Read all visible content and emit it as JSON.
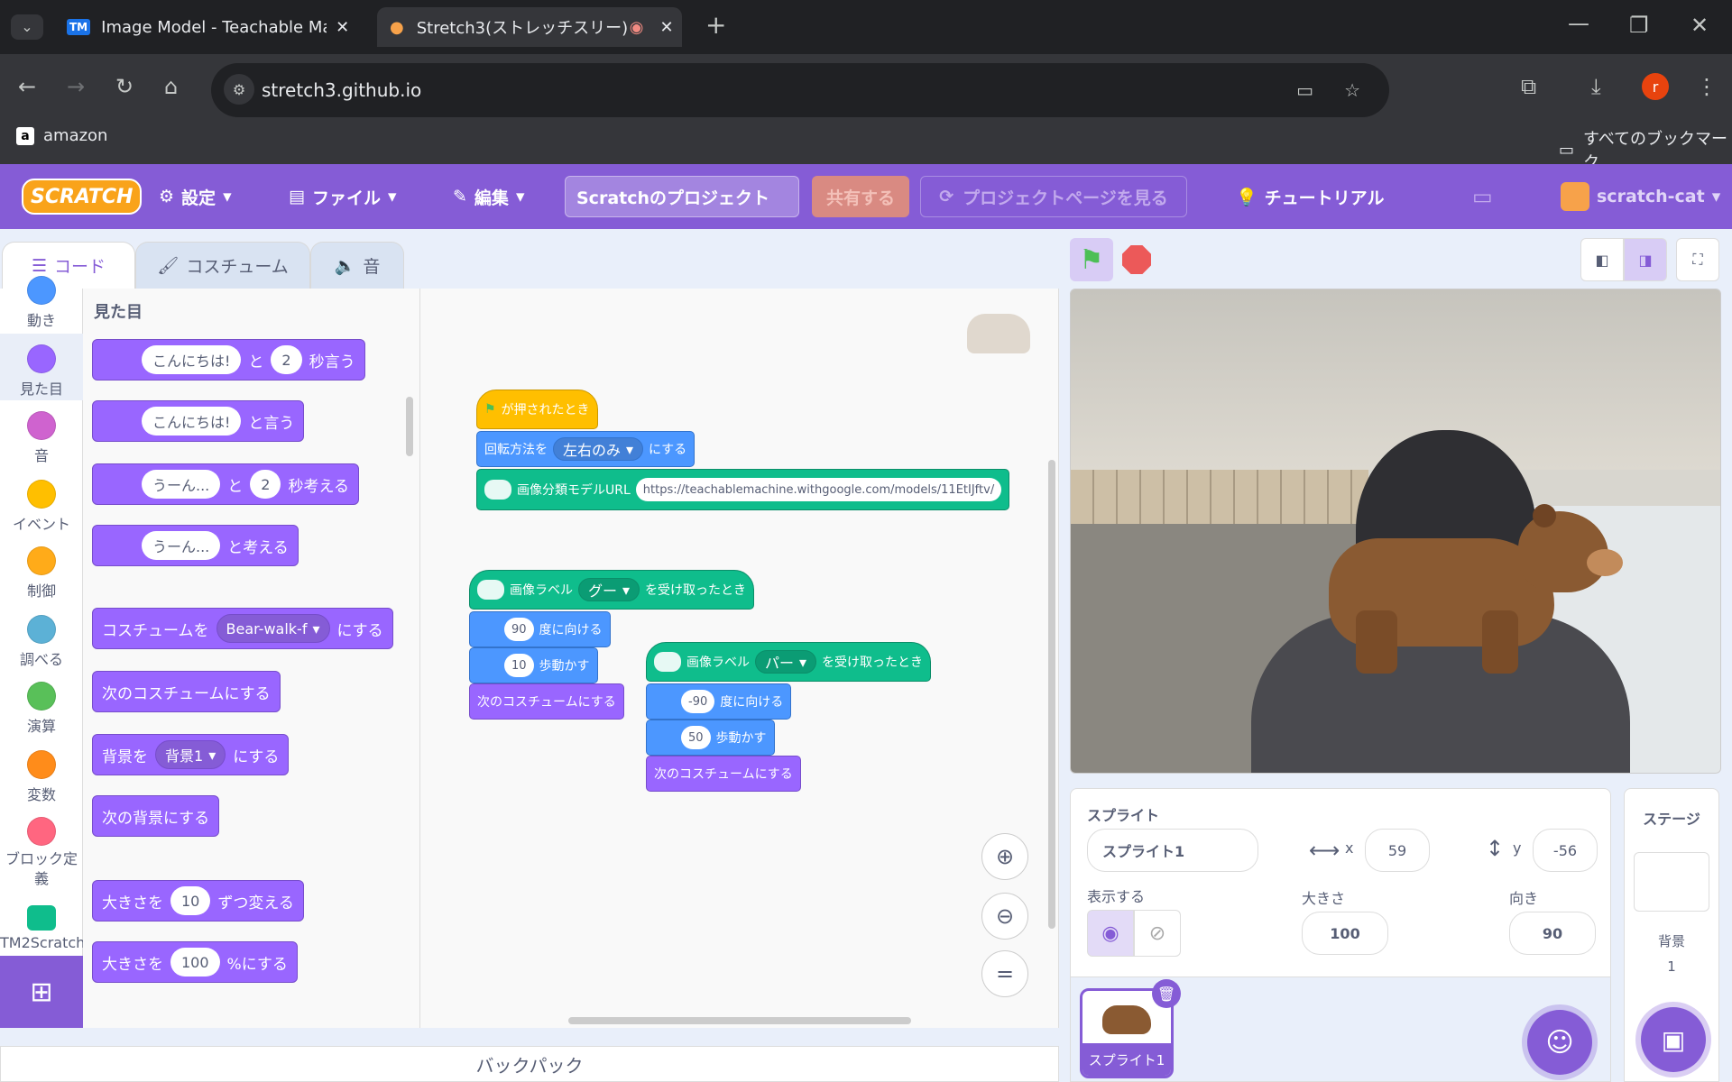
{
  "browser": {
    "tabs": [
      {
        "label": "Image Model - Teachable Mach",
        "icon": "TM"
      },
      {
        "label": "Stretch3(ストレッチスリー)"
      }
    ],
    "url": "stretch3.github.io",
    "bookmark": "amazon",
    "all_bookmarks": "すべてのブックマーク",
    "profile_initial": "r"
  },
  "menu": {
    "logo": "SCRATCH",
    "settings": "設定",
    "file": "ファイル",
    "edit": "編集",
    "project_title": "Scratchのプロジェクト",
    "share": "共有する",
    "see_project": "プロジェクトページを見る",
    "tutorial": "チュートリアル",
    "user": "scratch-cat"
  },
  "tabs": {
    "code": "コード",
    "costume": "コスチューム",
    "sound": "音"
  },
  "categories": [
    "動き",
    "見た目",
    "音",
    "イベント",
    "制御",
    "調べる",
    "演算",
    "変数",
    "ブロック定義",
    "TM2Scratch"
  ],
  "palette": {
    "heading": "見た目",
    "say_for": {
      "text": "こんにちは!",
      "mid": "と",
      "num": "2",
      "end": "秒言う"
    },
    "say": {
      "text": "こんにちは!",
      "end": "と言う"
    },
    "think_for": {
      "text": "うーん...",
      "mid": "と",
      "num": "2",
      "end": "秒考える"
    },
    "think": {
      "text": "うーん...",
      "end": "と考える"
    },
    "switch_costume": {
      "start": "コスチュームを",
      "value": "Bear-walk-f",
      "end": "にする"
    },
    "next_costume": "次のコスチュームにする",
    "switch_backdrop": {
      "start": "背景を",
      "value": "背景1",
      "end": "にする"
    },
    "next_backdrop": "次の背景にする",
    "change_size": {
      "start": "大きさを",
      "num": "10",
      "end": "ずつ変える"
    },
    "set_size": {
      "start": "大きさを",
      "num": "100",
      "end": "%にする"
    }
  },
  "script": {
    "flag_hat": "が押されたとき",
    "rotation": {
      "start": "回転方法を",
      "value": "左右のみ",
      "end": "にする"
    },
    "model_url": {
      "label": "画像分類モデルURL",
      "value": "https://teachablemachine.withgoogle.com/models/11EtIJftv/"
    },
    "hat1": {
      "start": "画像ラベル",
      "value": "グー",
      "end": "を受け取ったとき"
    },
    "dir1": {
      "num": "90",
      "end": "度に向ける"
    },
    "move1": {
      "num": "10",
      "end": "歩動かす"
    },
    "next1": "次のコスチュームにする",
    "hat2": {
      "start": "画像ラベル",
      "value": "パー",
      "end": "を受け取ったとき"
    },
    "dir2": {
      "num": "-90",
      "end": "度に向ける"
    },
    "move2": {
      "num": "50",
      "end": "歩動かす"
    },
    "next2": "次のコスチュームにする"
  },
  "backpack": "バックパック",
  "sprite_info": {
    "label": "スプライト",
    "name": "スプライト1",
    "x_label": "x",
    "x": "59",
    "y_label": "y",
    "y": "-56",
    "show_label": "表示する",
    "size_label": "大きさ",
    "size": "100",
    "direction_label": "向き",
    "direction": "90"
  },
  "sprite_tile": "スプライト1",
  "stage_panel": {
    "title": "ステージ",
    "backdrop_label": "背景",
    "backdrop_count": "1"
  },
  "colors": {
    "accent": "#855cd6",
    "looks": "#9966ff",
    "motion": "#4c97ff",
    "extension": "#0fbd8c",
    "events": "#ffbf00"
  }
}
